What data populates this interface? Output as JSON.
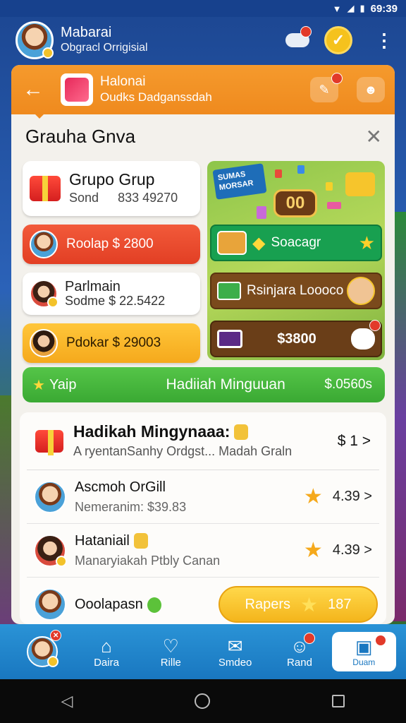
{
  "status_bar": {
    "time": "69:39"
  },
  "header": {
    "title": "Mabarai",
    "subtitle": "Obgracl Orrigisial"
  },
  "panel_header": {
    "title": "Halonai",
    "subtitle": "Oudks Dadganssdah"
  },
  "section": {
    "title": "Grauha Gnva"
  },
  "cards": {
    "grupo": {
      "title": "Grupo Grup",
      "sub_label": "Sond",
      "sub_value": "833 49270"
    },
    "rodlap": {
      "label": "Roolap $ 2800"
    },
    "parlmain": {
      "line1": "Parlmain",
      "line2_a": "Sodme",
      "line2_b": "$ 22.5422"
    },
    "pdokar": {
      "label": "Pdokar $ 29003"
    }
  },
  "promo": {
    "tag": "SUMAS MORSAR",
    "coin": "00",
    "row1_label": "Soacagr",
    "row2_label": "Rsinjara Loooco",
    "row3_amount": "$3800"
  },
  "weekly_bar": {
    "left": "Yaip",
    "center": "Hadiiah Minguuan",
    "right": "$.0560s"
  },
  "list": {
    "head": {
      "title": "Hadikah Mingynaaa:",
      "subtitle": "A ryentanSanhy Ordgst... Madah Graln",
      "amount": "$ 1 >"
    },
    "rows": [
      {
        "title": "Ascmoh OrGill",
        "subtitle": "Nemeranim: $39.83",
        "value": "4.39 >"
      },
      {
        "title": "Hataniail",
        "subtitle": "Manaryiakah Ptbly Canan",
        "value": "4.39 >"
      },
      {
        "title": "Ooolapasn",
        "button_label": "Rapers",
        "button_value": "187"
      }
    ]
  },
  "bottom_nav": {
    "items": [
      {
        "label": ""
      },
      {
        "label": "Daira"
      },
      {
        "label": "Rille"
      },
      {
        "label": "Smdeo"
      },
      {
        "label": "Rand"
      },
      {
        "label": "Duam"
      }
    ]
  },
  "colors": {
    "accent_orange": "#ef8a1e",
    "accent_green": "#3aa933",
    "accent_blue": "#1977c0",
    "badge_red": "#e23a2a"
  }
}
